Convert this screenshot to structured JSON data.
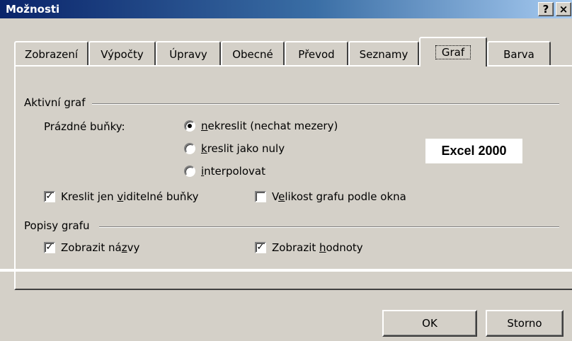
{
  "window": {
    "title": "Možnosti",
    "help_button": "?",
    "close_button": "×"
  },
  "tabs": [
    {
      "label": "Zobrazení"
    },
    {
      "label": "Výpočty"
    },
    {
      "label": "Úpravy"
    },
    {
      "label": "Obecné"
    },
    {
      "label": "Převod"
    },
    {
      "label": "Seznamy"
    },
    {
      "label": "Graf",
      "active": true
    },
    {
      "label": "Barva"
    }
  ],
  "active_chart": {
    "group_label": "Aktivní graf",
    "empty_cells_label": "Prázdné buňky:",
    "radio_options": [
      {
        "pre": "",
        "accel": "n",
        "post": "ekreslit (nechat mezery)",
        "selected": true
      },
      {
        "pre": "",
        "accel": "k",
        "post": "reslit jako nuly",
        "selected": false
      },
      {
        "pre": "",
        "accel": "i",
        "post": "nterpolovat",
        "selected": false
      }
    ],
    "plot_visible_only": {
      "pre": "Kreslit jen ",
      "accel": "v",
      "post": "iditelné buňky",
      "checked": true
    },
    "size_with_window": {
      "pre": "V",
      "accel": "e",
      "post": "likost grafu podle okna",
      "checked": false
    }
  },
  "chart_tips": {
    "group_label": "Popisy grafu",
    "show_names": {
      "pre": "Zobrazit ná",
      "accel": "z",
      "post": "vy",
      "checked": true
    },
    "show_values": {
      "pre": "Zobrazit ",
      "accel": "h",
      "post": "odnoty",
      "checked": true
    }
  },
  "badge": "Excel 2000",
  "buttons": {
    "ok": "OK",
    "cancel": "Storno"
  },
  "check_glyph": "✓"
}
